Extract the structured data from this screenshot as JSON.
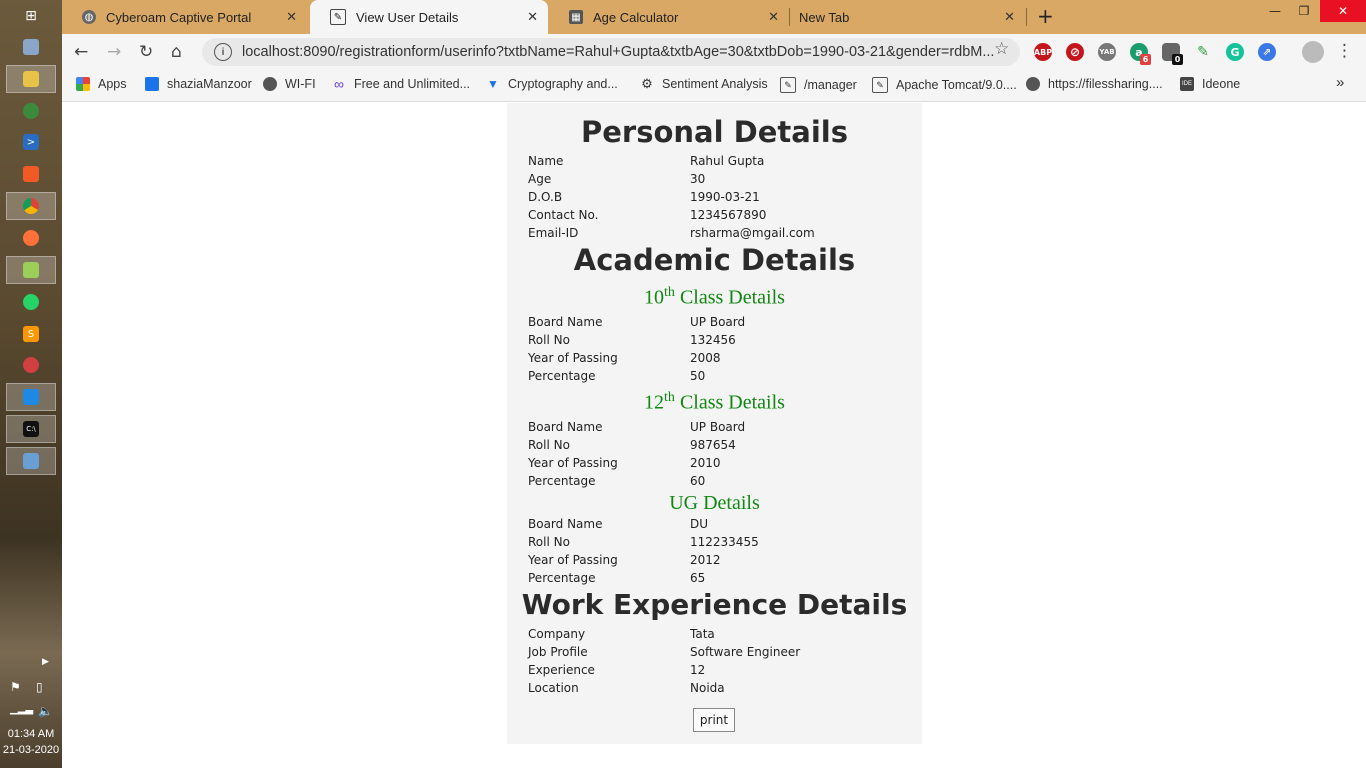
{
  "taskbar": {
    "time": "01:34 AM",
    "date": "21-03-2020"
  },
  "tabs": [
    {
      "title": "Cyberoam Captive Portal",
      "close": "✕"
    },
    {
      "title": "View User Details",
      "close": "✕"
    },
    {
      "title": "Age Calculator",
      "close": "✕"
    },
    {
      "title": "New Tab",
      "close": "✕"
    }
  ],
  "new_tab_label": "+",
  "address_bar": {
    "url": "localhost:8090/registrationform/userinfo?txtbName=Rahul+Gupta&txtbAge=30&txtbDob=1990-03-21&gender=rdbM..."
  },
  "extensions": [
    {
      "name": "adblock-icon",
      "label": "ABP",
      "color": "#c4161c"
    },
    {
      "name": "block-icon",
      "label": "⊘",
      "color": "#c4161c"
    },
    {
      "name": "yab-icon",
      "label": "YAB",
      "color": "#777777"
    },
    {
      "name": "grammar-icon",
      "label": "a",
      "color": "#1a9c6c",
      "badge": "6"
    },
    {
      "name": "extension-counter-icon",
      "label": "",
      "color": "#555555",
      "badge": "0"
    },
    {
      "name": "pen-icon",
      "label": "✎",
      "color": "#2ea043"
    },
    {
      "name": "grammarly-icon",
      "label": "G",
      "color": "#15c39a"
    },
    {
      "name": "link-icon",
      "label": "⇗",
      "color": "#3b78e7"
    }
  ],
  "bookmarks": [
    {
      "label": "Apps"
    },
    {
      "label": "shaziaManzoor"
    },
    {
      "label": "WI-FI"
    },
    {
      "label": "Free and Unlimited..."
    },
    {
      "label": "Cryptography and..."
    },
    {
      "label": "Sentiment Analysis"
    },
    {
      "label": "/manager"
    },
    {
      "label": "Apache Tomcat/9.0...."
    },
    {
      "label": "https://filessharing...."
    },
    {
      "label": "Ideone"
    }
  ],
  "bookmarks_more": "»",
  "content": {
    "personal_title": "Personal Details",
    "personal": [
      {
        "label": "Name",
        "value": "Rahul Gupta"
      },
      {
        "label": "Age",
        "value": "30"
      },
      {
        "label": "D.O.B",
        "value": "1990-03-21"
      },
      {
        "label": "Contact No.",
        "value": "1234567890"
      },
      {
        "label": "Email-ID",
        "value": "rsharma@mgail.com"
      }
    ],
    "academic_title": "Academic Details",
    "class10": {
      "num": "10",
      "sup": "th",
      "rest": " Class Details",
      "rows": [
        {
          "label": "Board Name",
          "value": "UP Board"
        },
        {
          "label": "Roll No",
          "value": "132456"
        },
        {
          "label": "Year of Passing",
          "value": "2008"
        },
        {
          "label": "Percentage",
          "value": "50"
        }
      ]
    },
    "class12": {
      "num": "12",
      "sup": "th",
      "rest": " Class Details",
      "rows": [
        {
          "label": "Board Name",
          "value": "UP Board"
        },
        {
          "label": "Roll No",
          "value": "987654"
        },
        {
          "label": "Year of Passing",
          "value": "2010"
        },
        {
          "label": "Percentage",
          "value": "60"
        }
      ]
    },
    "ug": {
      "title": "UG Details",
      "rows": [
        {
          "label": "Board Name",
          "value": "DU"
        },
        {
          "label": "Roll No",
          "value": "112233455"
        },
        {
          "label": "Year of Passing",
          "value": "2012"
        },
        {
          "label": "Percentage",
          "value": "65"
        }
      ]
    },
    "work_title": "Work Experience Details",
    "work": [
      {
        "label": "Company",
        "value": "Tata"
      },
      {
        "label": "Job Profile",
        "value": "Software Engineer"
      },
      {
        "label": "Experience",
        "value": "12"
      },
      {
        "label": "Location",
        "value": "Noida"
      }
    ],
    "print_label": "print"
  }
}
